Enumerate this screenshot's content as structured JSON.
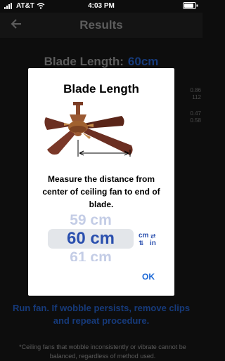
{
  "status_bar": {
    "carrier": "AT&T",
    "time": "4:03 PM"
  },
  "nav": {
    "title": "Results"
  },
  "background": {
    "blade_length_label": "Blade Length:",
    "blade_length_value": "60cm",
    "side_values": [
      "0.86",
      "112",
      "0.47",
      "0.58"
    ],
    "instruction": "Run fan. If wobble persists, remove clips and repeat procedure.",
    "footnote": "*Ceiling fans that wobble inconsistently or vibrate cannot be balanced, regardless of method used."
  },
  "dialog": {
    "title": "Blade Length",
    "description": "Measure the distance from center of ceiling fan to end of blade.",
    "picker": {
      "above": "59 cm",
      "selected": "60 cm",
      "below": "61 cm"
    },
    "unit_toggle": {
      "unit_a": "cm",
      "unit_b": "in"
    },
    "ok_label": "OK"
  },
  "colors": {
    "background": "#0d0d0d",
    "accent_blue": "#2a4fae",
    "ok_blue": "#1a67d6",
    "fan_wood": "#6b2f22"
  },
  "icons": [
    "signal-bars-icon",
    "wifi-icon",
    "battery-icon",
    "back-arrow-icon",
    "ceiling-fan-illustration",
    "swap-units-icon"
  ]
}
